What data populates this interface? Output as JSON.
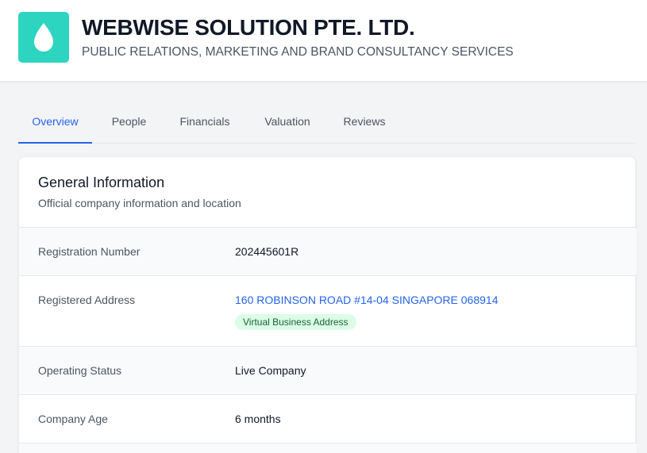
{
  "company": {
    "name": "WEBWISE SOLUTION PTE. LTD.",
    "tagline": "PUBLIC RELATIONS, MARKETING AND BRAND CONSULTANCY SERVICES",
    "logo_icon": "droplet-icon",
    "logo_color": "#2dd4bf"
  },
  "tabs": [
    {
      "label": "Overview",
      "active": true
    },
    {
      "label": "People",
      "active": false
    },
    {
      "label": "Financials",
      "active": false
    },
    {
      "label": "Valuation",
      "active": false
    },
    {
      "label": "Reviews",
      "active": false
    }
  ],
  "general": {
    "title": "General Information",
    "subtitle": "Official company information and location",
    "rows": [
      {
        "label": "Registration Number",
        "value": "202445601R"
      },
      {
        "label": "Registered Address",
        "value": "160 ROBINSON ROAD #14-04 SINGAPORE 068914",
        "badge": "Virtual Business Address"
      },
      {
        "label": "Operating Status",
        "value": "Live Company"
      },
      {
        "label": "Company Age",
        "value": "6 months"
      }
    ]
  },
  "colors": {
    "accent": "#2563eb",
    "badge_bg": "#dcfce7",
    "badge_text": "#166534"
  }
}
